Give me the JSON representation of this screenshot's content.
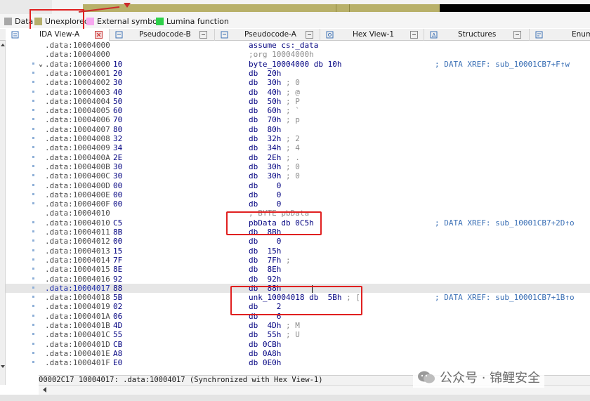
{
  "legend": [
    {
      "label": "Data",
      "color": "#a8a8a8"
    },
    {
      "label": "Unexplored",
      "color": "#b5ae6a"
    },
    {
      "label": "External symbol",
      "color": "#f7a8ef"
    },
    {
      "label": "Lumina function",
      "color": "#2fd04a"
    }
  ],
  "tabs": [
    {
      "label": "IDA View-A",
      "active": true
    },
    {
      "label": "Pseudocode-B",
      "active": false
    },
    {
      "label": "Pseudocode-A",
      "active": false
    },
    {
      "label": "Hex View-1",
      "active": false
    },
    {
      "label": "Structures",
      "active": false
    },
    {
      "label": "Enums",
      "active": false
    }
  ],
  "listing": [
    {
      "addr": ".data:10004000",
      "bytes": "",
      "instr": "assume cs:_data",
      "style": "plain",
      "xref": "",
      "dot": false
    },
    {
      "addr": ".data:10004000",
      "bytes": "",
      "instr": ";org 10004000h",
      "style": "gray",
      "xref": "",
      "dot": false
    },
    {
      "addr": ".data:10004000",
      "bytes": "10",
      "instr": "byte_10004000 db 10h",
      "style": "plain",
      "xref": "; DATA XREF: sub_10001CB7+F↑w",
      "dot": true,
      "fold": true
    },
    {
      "addr": ".data:10004001",
      "bytes": "20",
      "instr": "db  20h",
      "style": "plain",
      "xref": "",
      "dot": true
    },
    {
      "addr": ".data:10004002",
      "bytes": "30",
      "instr": "db  30h",
      "cmt": " ; 0",
      "style": "plain",
      "xref": "",
      "dot": true
    },
    {
      "addr": ".data:10004003",
      "bytes": "40",
      "instr": "db  40h",
      "cmt": " ; @",
      "style": "plain",
      "xref": "",
      "dot": true
    },
    {
      "addr": ".data:10004004",
      "bytes": "50",
      "instr": "db  50h",
      "cmt": " ; P",
      "style": "plain",
      "xref": "",
      "dot": true
    },
    {
      "addr": ".data:10004005",
      "bytes": "60",
      "instr": "db  60h",
      "cmt": " ; `",
      "style": "plain",
      "xref": "",
      "dot": true
    },
    {
      "addr": ".data:10004006",
      "bytes": "70",
      "instr": "db  70h",
      "cmt": " ; p",
      "style": "plain",
      "xref": "",
      "dot": true
    },
    {
      "addr": ".data:10004007",
      "bytes": "80",
      "instr": "db  80h",
      "style": "plain",
      "xref": "",
      "dot": true
    },
    {
      "addr": ".data:10004008",
      "bytes": "32",
      "instr": "db  32h",
      "cmt": " ; 2",
      "style": "plain",
      "xref": "",
      "dot": true
    },
    {
      "addr": ".data:10004009",
      "bytes": "34",
      "instr": "db  34h",
      "cmt": " ; 4",
      "style": "plain",
      "xref": "",
      "dot": true
    },
    {
      "addr": ".data:1000400A",
      "bytes": "2E",
      "instr": "db  2Eh",
      "cmt": " ; .",
      "style": "plain",
      "xref": "",
      "dot": true
    },
    {
      "addr": ".data:1000400B",
      "bytes": "30",
      "instr": "db  30h",
      "cmt": " ; 0",
      "style": "plain",
      "xref": "",
      "dot": true
    },
    {
      "addr": ".data:1000400C",
      "bytes": "30",
      "instr": "db  30h",
      "cmt": " ; 0",
      "style": "plain",
      "xref": "",
      "dot": true
    },
    {
      "addr": ".data:1000400D",
      "bytes": "00",
      "instr": "db    0",
      "style": "plain",
      "xref": "",
      "dot": true
    },
    {
      "addr": ".data:1000400E",
      "bytes": "00",
      "instr": "db    0",
      "style": "plain",
      "xref": "",
      "dot": true
    },
    {
      "addr": ".data:1000400F",
      "bytes": "00",
      "instr": "db    0",
      "style": "plain",
      "xref": "",
      "dot": true
    },
    {
      "addr": ".data:10004010",
      "bytes": "",
      "instr": "; BYTE pbData",
      "style": "gray",
      "xref": "",
      "dot": false
    },
    {
      "addr": ".data:10004010",
      "bytes": "C5",
      "instr": "pbData db 0C5h",
      "style": "plain",
      "xref": "; DATA XREF: sub_10001CB7+2D↑o",
      "dot": true
    },
    {
      "addr": ".data:10004011",
      "bytes": "8B",
      "instr": "db  8Bh",
      "style": "plain",
      "xref": "",
      "dot": true
    },
    {
      "addr": ".data:10004012",
      "bytes": "00",
      "instr": "db    0",
      "style": "plain",
      "xref": "",
      "dot": true
    },
    {
      "addr": ".data:10004013",
      "bytes": "15",
      "instr": "db  15h",
      "style": "plain",
      "xref": "",
      "dot": true
    },
    {
      "addr": ".data:10004014",
      "bytes": "7F",
      "instr": "db  7Fh",
      "cmt": " ;",
      "style": "plain",
      "xref": "",
      "dot": true
    },
    {
      "addr": ".data:10004015",
      "bytes": "8E",
      "instr": "db  8Eh",
      "style": "plain",
      "xref": "",
      "dot": true
    },
    {
      "addr": ".data:10004016",
      "bytes": "92",
      "instr": "db  92h",
      "style": "plain",
      "xref": "",
      "dot": true
    },
    {
      "addr": ".data:10004017",
      "bytes": "88",
      "instr": "db  88h",
      "style": "plain",
      "xref": "",
      "dot": true,
      "selected": true
    },
    {
      "addr": ".data:10004018",
      "bytes": "5B",
      "instr": "unk_10004018 db  5Bh",
      "cmt": " ; [",
      "style": "plain",
      "xref": "; DATA XREF: sub_10001CB7+1B↑o",
      "dot": true
    },
    {
      "addr": ".data:10004019",
      "bytes": "02",
      "instr": "db    2",
      "style": "plain",
      "xref": "",
      "dot": true
    },
    {
      "addr": ".data:1000401A",
      "bytes": "06",
      "instr": "db    6",
      "style": "plain",
      "xref": "",
      "dot": true
    },
    {
      "addr": ".data:1000401B",
      "bytes": "4D",
      "instr": "db  4Dh",
      "cmt": " ; M",
      "style": "plain",
      "xref": "",
      "dot": true
    },
    {
      "addr": ".data:1000401C",
      "bytes": "55",
      "instr": "db  55h",
      "cmt": " ; U",
      "style": "plain",
      "xref": "",
      "dot": true
    },
    {
      "addr": ".data:1000401D",
      "bytes": "CB",
      "instr": "db 0CBh",
      "style": "plain",
      "xref": "",
      "dot": true
    },
    {
      "addr": ".data:1000401E",
      "bytes": "A8",
      "instr": "db 0A8h",
      "style": "plain",
      "xref": "",
      "dot": true
    },
    {
      "addr": ".data:1000401F",
      "bytes": "E0",
      "instr": "db 0E0h",
      "style": "plain",
      "xref": "",
      "dot": true
    }
  ],
  "status": "00002C17 10004017: .data:10004017 (Synchronized with Hex View-1)",
  "watermark": "公众号 · 锦鲤安全"
}
